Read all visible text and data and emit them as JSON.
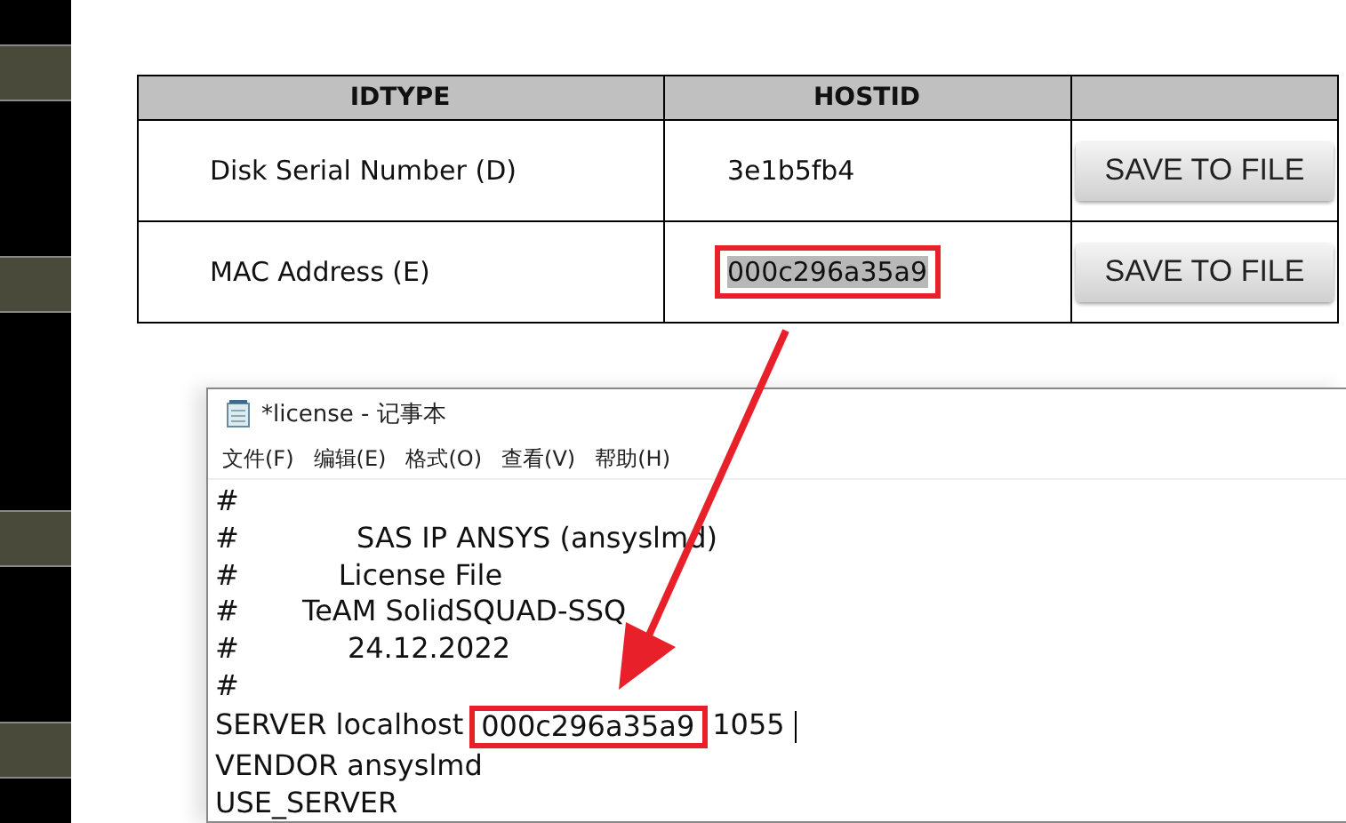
{
  "table": {
    "columns": [
      "IDTYPE",
      "HOSTID",
      ""
    ],
    "rows": [
      {
        "idtype": "Disk Serial Number (D)",
        "hostid": "3e1b5fb4",
        "hostid_selected": false,
        "marked": false,
        "button": "SAVE TO FILE"
      },
      {
        "idtype": "MAC Address (E)",
        "hostid": "000c296a35a9",
        "hostid_selected": true,
        "marked": true,
        "button": "SAVE TO FILE"
      }
    ]
  },
  "notepad": {
    "title": "*license - 记事本",
    "menu": [
      "文件(F)",
      "编辑(E)",
      "格式(O)",
      "查看(V)",
      "帮助(H)"
    ],
    "lines": [
      {
        "text": "#"
      },
      {
        "text": "#             SAS IP ANSYS (ansyslmd)"
      },
      {
        "text": "#           License File"
      },
      {
        "text": "#       TeAM SolidSQUAD-SSQ"
      },
      {
        "text": "#            24.12.2022"
      },
      {
        "text": "#"
      },
      {
        "text": "SERVER localhost",
        "marked": "000c296a35a9",
        "after": "1055",
        "cursor": true
      },
      {
        "text": "VENDOR ansyslmd"
      },
      {
        "text": "USE_SERVER"
      }
    ]
  }
}
